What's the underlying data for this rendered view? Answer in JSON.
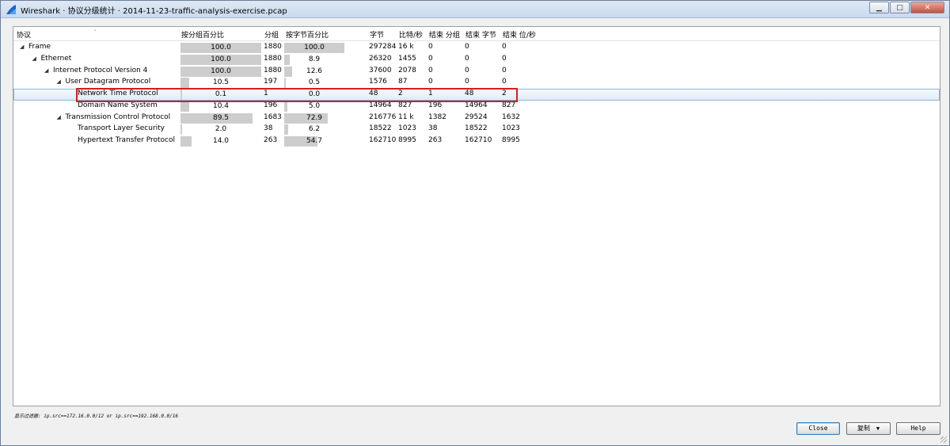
{
  "window": {
    "title": "Wireshark · 协议分级统计 · 2014-11-23-traffic-analysis-exercise.pcap",
    "minimize_glyph": "▁",
    "maximize_glyph": "□",
    "close_glyph": "✕"
  },
  "table": {
    "columns": [
      "协议",
      "按分组百分比",
      "分组",
      "按字节百分比",
      "字节",
      "比特/秒",
      "结束 分组",
      "结束 字节",
      "结束 位/秒"
    ],
    "rows": [
      {
        "name": "Frame",
        "indent": 0,
        "expandable": true,
        "pct_packets": "100.0",
        "pct_packets_value": 100.0,
        "packets": "1880",
        "pct_bytes": "100.0",
        "pct_bytes_value": 100.0,
        "bytes": "297284",
        "bits_s": "16 k",
        "end_packets": "0",
        "end_bytes": "0",
        "end_bits_s": "0"
      },
      {
        "name": "Ethernet",
        "indent": 1,
        "expandable": true,
        "pct_packets": "100.0",
        "pct_packets_value": 100.0,
        "packets": "1880",
        "pct_bytes": "8.9",
        "pct_bytes_value": 8.9,
        "bytes": "26320",
        "bits_s": "1455",
        "end_packets": "0",
        "end_bytes": "0",
        "end_bits_s": "0"
      },
      {
        "name": "Internet Protocol Version 4",
        "indent": 2,
        "expandable": true,
        "pct_packets": "100.0",
        "pct_packets_value": 100.0,
        "packets": "1880",
        "pct_bytes": "12.6",
        "pct_bytes_value": 12.6,
        "bytes": "37600",
        "bits_s": "2078",
        "end_packets": "0",
        "end_bytes": "0",
        "end_bits_s": "0"
      },
      {
        "name": "User Datagram Protocol",
        "indent": 3,
        "expandable": true,
        "pct_packets": "10.5",
        "pct_packets_value": 10.5,
        "packets": "197",
        "pct_bytes": "0.5",
        "pct_bytes_value": 0.5,
        "bytes": "1576",
        "bits_s": "87",
        "end_packets": "0",
        "end_bytes": "0",
        "end_bits_s": "0"
      },
      {
        "name": "Network Time Protocol",
        "indent": 4,
        "expandable": false,
        "selected": true,
        "pct_packets": "0.1",
        "pct_packets_value": 0.1,
        "packets": "1",
        "pct_bytes": "0.0",
        "pct_bytes_value": 0.0,
        "bytes": "48",
        "bits_s": "2",
        "end_packets": "1",
        "end_bytes": "48",
        "end_bits_s": "2"
      },
      {
        "name": "Domain Name System",
        "indent": 4,
        "expandable": false,
        "pct_packets": "10.4",
        "pct_packets_value": 10.4,
        "packets": "196",
        "pct_bytes": "5.0",
        "pct_bytes_value": 5.0,
        "bytes": "14964",
        "bits_s": "827",
        "end_packets": "196",
        "end_bytes": "14964",
        "end_bits_s": "827"
      },
      {
        "name": "Transmission Control Protocol",
        "indent": 3,
        "expandable": true,
        "pct_packets": "89.5",
        "pct_packets_value": 89.5,
        "packets": "1683",
        "pct_bytes": "72.9",
        "pct_bytes_value": 72.9,
        "bytes": "216776",
        "bits_s": "11 k",
        "end_packets": "1382",
        "end_bytes": "29524",
        "end_bits_s": "1632"
      },
      {
        "name": "Transport Layer Security",
        "indent": 4,
        "expandable": false,
        "pct_packets": "2.0",
        "pct_packets_value": 2.0,
        "packets": "38",
        "pct_bytes": "6.2",
        "pct_bytes_value": 6.2,
        "bytes": "18522",
        "bits_s": "1023",
        "end_packets": "38",
        "end_bytes": "18522",
        "end_bits_s": "1023"
      },
      {
        "name": "Hypertext Transfer Protocol",
        "indent": 4,
        "expandable": false,
        "pct_packets": "14.0",
        "pct_packets_value": 14.0,
        "packets": "263",
        "pct_bytes": "54.7",
        "pct_bytes_value": 54.7,
        "bytes": "162710",
        "bits_s": "8995",
        "end_packets": "263",
        "end_bytes": "162710",
        "end_bits_s": "8995"
      }
    ]
  },
  "footer": {
    "display_filter": "显示过滤器: ip.src==172.16.0.0/12 or ip.src==192.168.0.0/16",
    "close_label": "Close",
    "copy_label": "复制",
    "help_label": "Help"
  },
  "colors": {
    "bar": "#cdcdcd",
    "selection": "#dfeaf6",
    "highlight_box": "#d11f1f"
  }
}
